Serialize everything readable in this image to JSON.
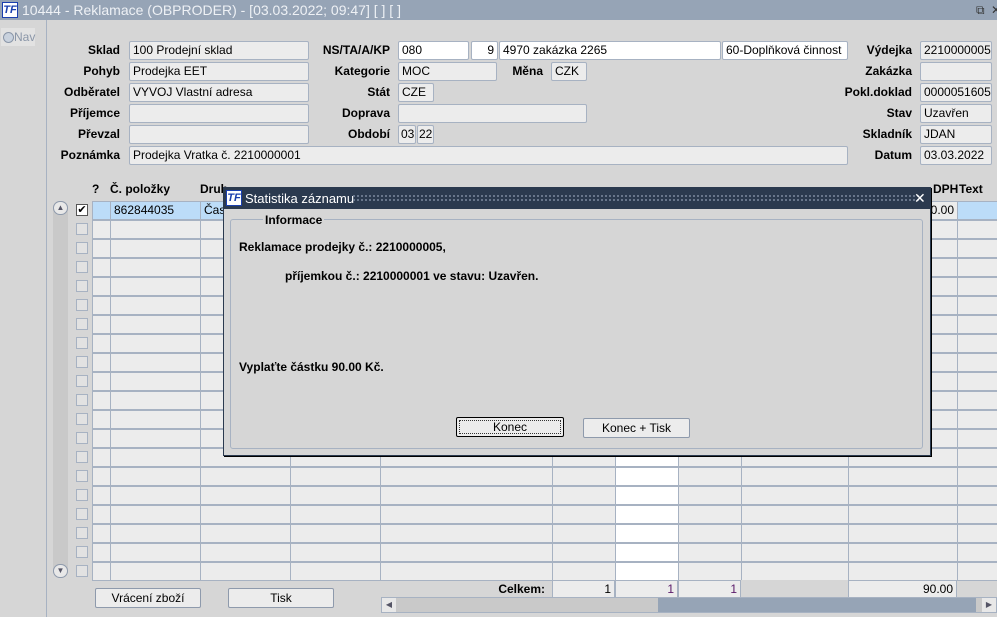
{
  "window": {
    "title": "10444 - Reklamace (OBPRODER) - [03.03.2022; 09:47]  [ ]  [ ]",
    "logo": "TF",
    "restore_icon": "restore-icon",
    "close_icon": "close-icon"
  },
  "sidebar": {
    "nav_label": "Nav"
  },
  "form": {
    "sklad": {
      "label": "Sklad",
      "value": "100 Prodejní sklad"
    },
    "pohyb": {
      "label": "Pohyb",
      "value": "Prodejka EET"
    },
    "odberatel": {
      "label": "Odběratel",
      "value": "VYVOJ Vlastní adresa"
    },
    "prijemce": {
      "label": "Příjemce",
      "value": ""
    },
    "prevzal": {
      "label": "Převzal",
      "value": ""
    },
    "poznamka": {
      "label": "Poznámka",
      "value": "Prodejka Vratka č. 2210000001"
    },
    "nstaakp": {
      "label": "NS/TA/A/KP",
      "ns": "080",
      "ta": "9",
      "a": "4970 zakázka 2265",
      "kp": "60-Doplňková činnost"
    },
    "kategorie": {
      "label": "Kategorie",
      "value": "MOC"
    },
    "mena": {
      "label": "Měna",
      "value": "CZK"
    },
    "stat": {
      "label": "Stát",
      "value": "CZE"
    },
    "doprava": {
      "label": "Doprava",
      "value": ""
    },
    "obdobi": {
      "label": "Období",
      "month": "03",
      "year": "22"
    },
    "vydejka": {
      "label": "Výdejka",
      "value": "2210000005"
    },
    "zakazka": {
      "label": "Zakázka",
      "value": ""
    },
    "pokl_doklad": {
      "label": "Pokl.doklad",
      "value": "0000051605"
    },
    "stav": {
      "label": "Stav",
      "value": "Uzavřen"
    },
    "skladnik": {
      "label": "Skladník",
      "value": "JDAN"
    },
    "datum": {
      "label": "Datum",
      "value": "03.03.2022"
    }
  },
  "table": {
    "headers": {
      "q": "?",
      "cislo": "Č. položky",
      "druh": "Druh",
      "dph": "DPH",
      "text": "Text"
    },
    "rows": [
      {
        "checked": true,
        "cislo": "862844035",
        "druh": "Čas",
        "amount": "90.00"
      }
    ],
    "totals": {
      "label": "Celkem:",
      "c1": "1",
      "c2": "1",
      "c3": "1",
      "c4": "",
      "amount": "90.00"
    }
  },
  "buttons": {
    "vraceni": "Vrácení zboží",
    "tisk": "Tisk"
  },
  "dialog": {
    "title": "Statistika záznamu",
    "logo": "TF",
    "group_label": "Informace",
    "line1": "Reklamace prodejky č.: 2210000005,",
    "line2": "příjemkou č.: 2210000001 ve stavu: Uzavřen.",
    "line3": "Vyplaťte částku 90.00 Kč.",
    "ok": "Konec",
    "ok_print": "Konec + Tisk"
  }
}
